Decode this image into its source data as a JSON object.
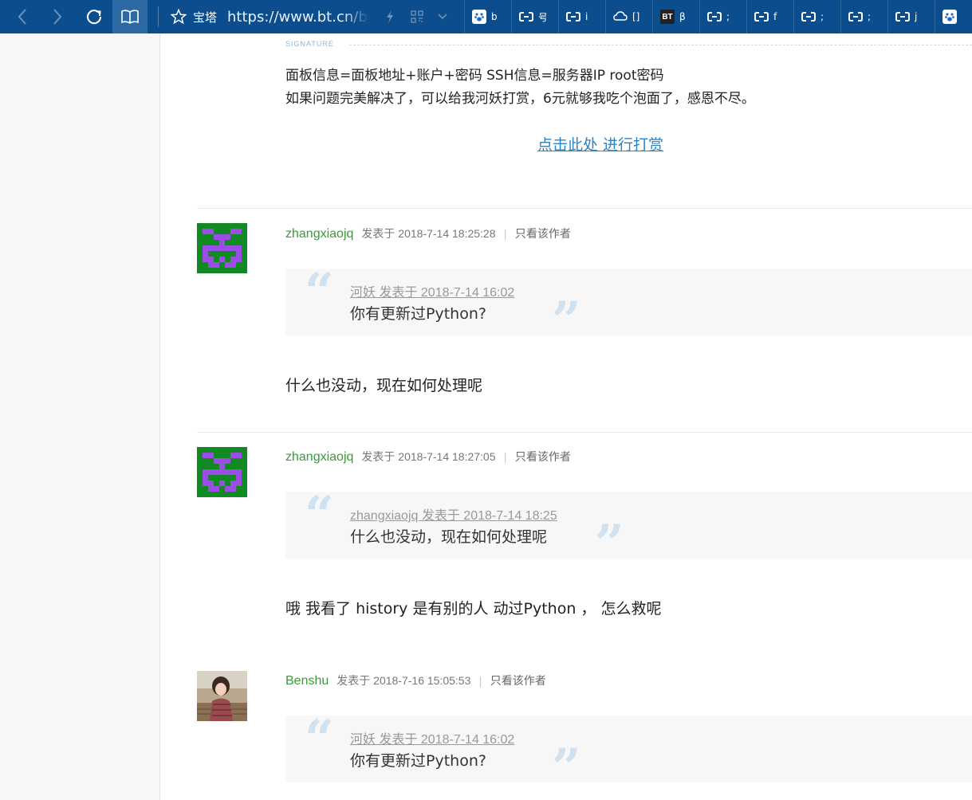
{
  "browser": {
    "site_name": "宝塔",
    "url": "https://www.bt.cn/bbs/thread",
    "bookmarks": [
      {
        "icon": "paw-icon",
        "label": "b"
      },
      {
        "icon": "link-icon",
        "label": "号"
      },
      {
        "icon": "link-icon",
        "label": "i"
      },
      {
        "icon": "cloud-icon",
        "label": "[]"
      },
      {
        "icon": "bt-icon",
        "icon_text": "BT",
        "label": "β"
      },
      {
        "icon": "link-icon",
        "label": ";"
      },
      {
        "icon": "link-icon",
        "label": "f"
      },
      {
        "icon": "link-icon",
        "label": ";"
      },
      {
        "icon": "link-icon",
        "label": ";"
      },
      {
        "icon": "link-icon",
        "label": "j"
      },
      {
        "icon": "paw-icon",
        "label": ""
      }
    ]
  },
  "signature": {
    "label": "SIGNATURE",
    "line1": "面板信息=面板地址+账户+密码 SSH信息=服务器IP root密码",
    "line2": "如果问题完美解决了，可以给我河妖打赏，6元就够我吃个泡面了，感恩不尽。",
    "reward_link": "点击此处 进行打赏"
  },
  "only_author_label": "只看该作者",
  "posts": [
    {
      "author": "zhangxiaojq",
      "time": "发表于 2018-7-14 18:25:28",
      "quote_cite": "河妖 发表于 2018-7-14 16:02",
      "quote_text": "你有更新过Python?",
      "body": "什么也没动，现在如何处理呢"
    },
    {
      "author": "zhangxiaojq",
      "time": "发表于 2018-7-14 18:27:05",
      "quote_cite": "zhangxiaojq 发表于 2018-7-14 18:25",
      "quote_text": "什么也没动，现在如何处理呢",
      "body": "哦 我看了 history  是有别的人 动过Python  ，  怎么救呢"
    },
    {
      "author": "Benshu",
      "time": "发表于 2018-7-16 15:05:53",
      "quote_cite": "河妖 发表于 2018-7-14 16:02",
      "quote_text": "你有更新过Python?"
    }
  ],
  "colors": {
    "toolbar": "#0c4e8d",
    "author": "#3a9a3a",
    "link": "#2a83c6",
    "identicon_bg": "#118a24",
    "identicon_fg": "#9b4ee6"
  }
}
